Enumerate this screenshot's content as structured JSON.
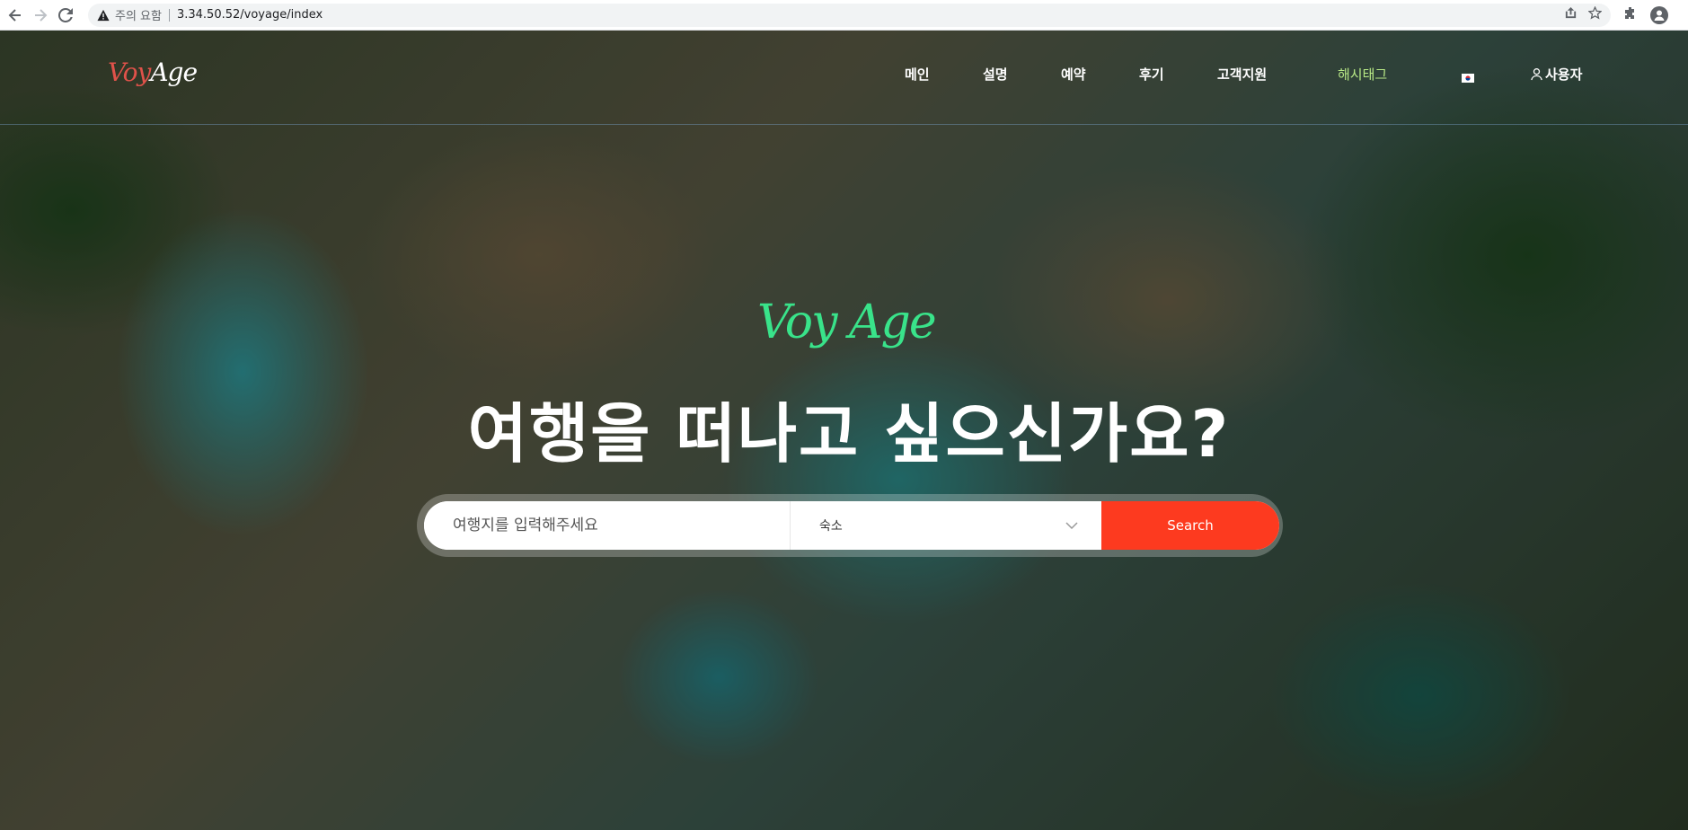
{
  "browser": {
    "security_label": "주의 요함",
    "url": "3.34.50.52/voyage/index"
  },
  "site": {
    "logo": {
      "part1": "Voy",
      "part2": "Age"
    },
    "nav": {
      "items": [
        "메인",
        "설명",
        "예약",
        "후기",
        "고객지원"
      ],
      "hashtag": "해시태그",
      "user": "사용자"
    }
  },
  "hero": {
    "logo": "Voy Age",
    "title": "여행을 떠나고 싶으신가요?"
  },
  "search": {
    "destination_placeholder": "여행지를 입력해주세요",
    "type_selected": "숙소",
    "button_label": "Search"
  },
  "colors": {
    "accent": "#fd3a1f",
    "hashtag": "#b8e986",
    "hero_logo": "#39e38a",
    "logo_voy": "#e0524a"
  }
}
